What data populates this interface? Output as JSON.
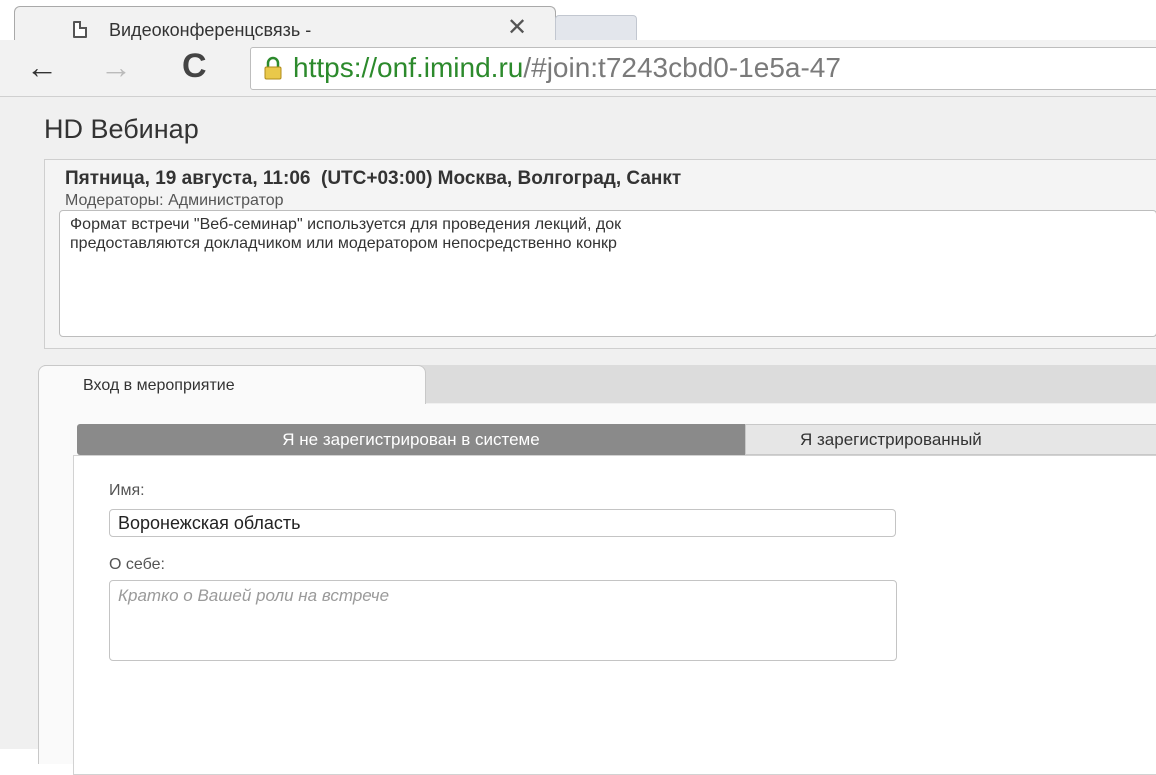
{
  "browser": {
    "tab_title": "Видеоконференцсвязь -",
    "tab_close": "✕",
    "url_scheme": "https://",
    "url_host": "onf.imind.ru",
    "url_path": "/#join:t7243cbd0-1e5a-47"
  },
  "app": {
    "title": "HD Вебинар"
  },
  "meeting": {
    "datetime": "Пятница, 19 августа, 11:06  (UTC+03:00) Москва, Волгоград, Санкт",
    "moderators": "Модераторы: Администратор",
    "description_line1": "Формат встречи \"Веб-семинар\" используется для проведения лекций, док",
    "description_line2": "предоставляются докладчиком или модератором непосредственно конкр"
  },
  "tabs": {
    "event_entry": "Вход в мероприятие"
  },
  "segments": {
    "unregistered": "Я не зарегистрирован в системе",
    "registered": "Я зарегистрированный"
  },
  "form": {
    "name_label": "Имя:",
    "name_value": "Воронежская область",
    "about_label": "О себе:",
    "about_placeholder": "Кратко о Вашей роли на встрече"
  }
}
